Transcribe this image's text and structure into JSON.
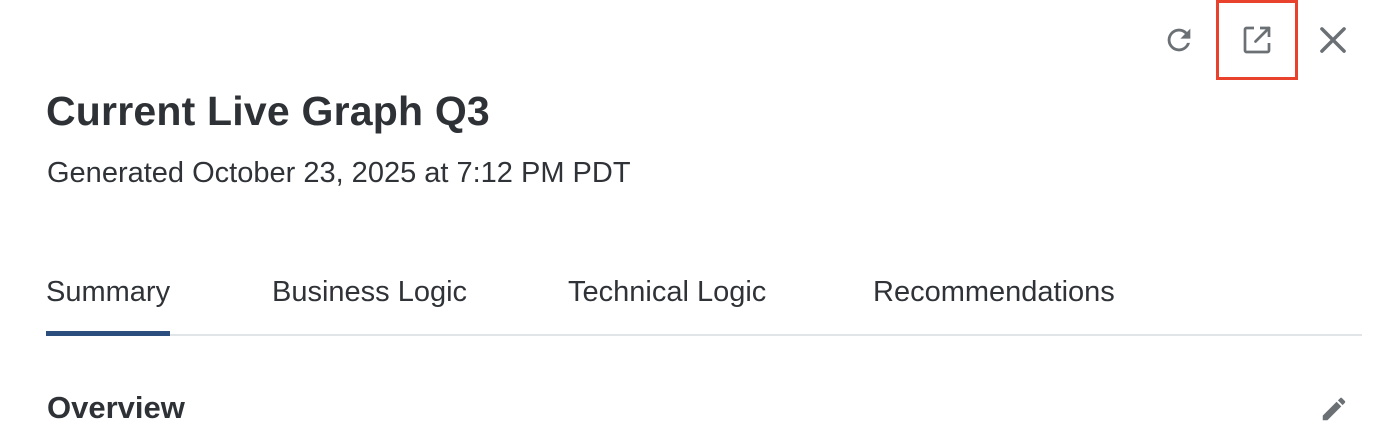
{
  "header": {
    "title": "Current Live Graph Q3",
    "subtitle": "Generated October 23, 2025 at 7:12 PM PDT"
  },
  "actions": {
    "refresh_icon": "refresh-icon",
    "popout_icon": "external-link-icon",
    "close_icon": "close-icon",
    "highlight_color": "#e8412c"
  },
  "tabs": [
    {
      "label": "Summary",
      "active": true
    },
    {
      "label": "Business Logic",
      "active": false
    },
    {
      "label": "Technical Logic",
      "active": false
    },
    {
      "label": "Recommendations",
      "active": false
    }
  ],
  "section": {
    "heading": "Overview",
    "edit_icon": "pencil-icon"
  },
  "colors": {
    "active_tab_underline": "#2b4e7e",
    "text": "#2f3337",
    "divider": "#e2e5e8"
  }
}
